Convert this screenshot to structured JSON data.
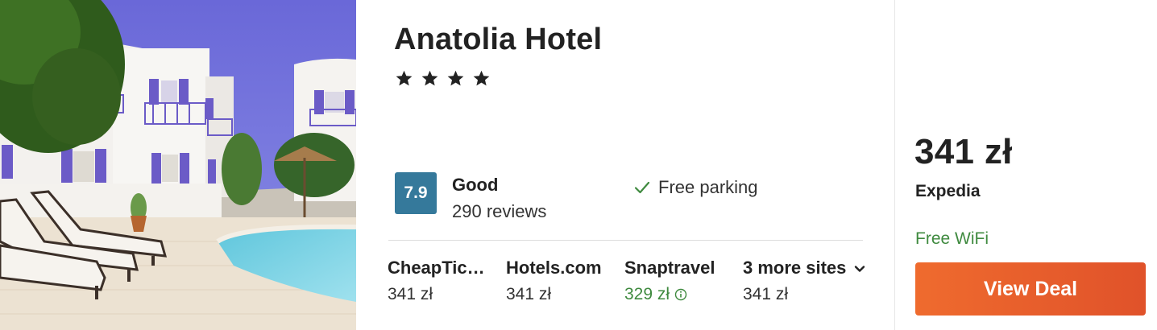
{
  "hotel": {
    "name": "Anatolia Hotel",
    "star_rating": 4,
    "photo_icon": "hotel-photo"
  },
  "rating": {
    "score": "7.9",
    "label": "Good",
    "reviews": "290 reviews",
    "badge_color": "#35799b"
  },
  "amenity": {
    "label": "Free parking",
    "icon": "check-icon"
  },
  "sites": [
    {
      "name": "CheapTic…",
      "price": "341 zł"
    },
    {
      "name": "Hotels.com",
      "price": "341 zł"
    },
    {
      "name": "Snaptravel",
      "price": "329 zł",
      "highlight_color": "#3f8a3f",
      "icon": "info-icon"
    },
    {
      "name": "3 more sites",
      "price": "341 zł",
      "icon": "chevron-down-icon"
    }
  ],
  "deal": {
    "price": "341 zł",
    "provider": "Expedia",
    "perk": "Free WiFi",
    "button_label": "View Deal",
    "button_color": "#e8602c",
    "perk_color": "#3f8a3f"
  }
}
